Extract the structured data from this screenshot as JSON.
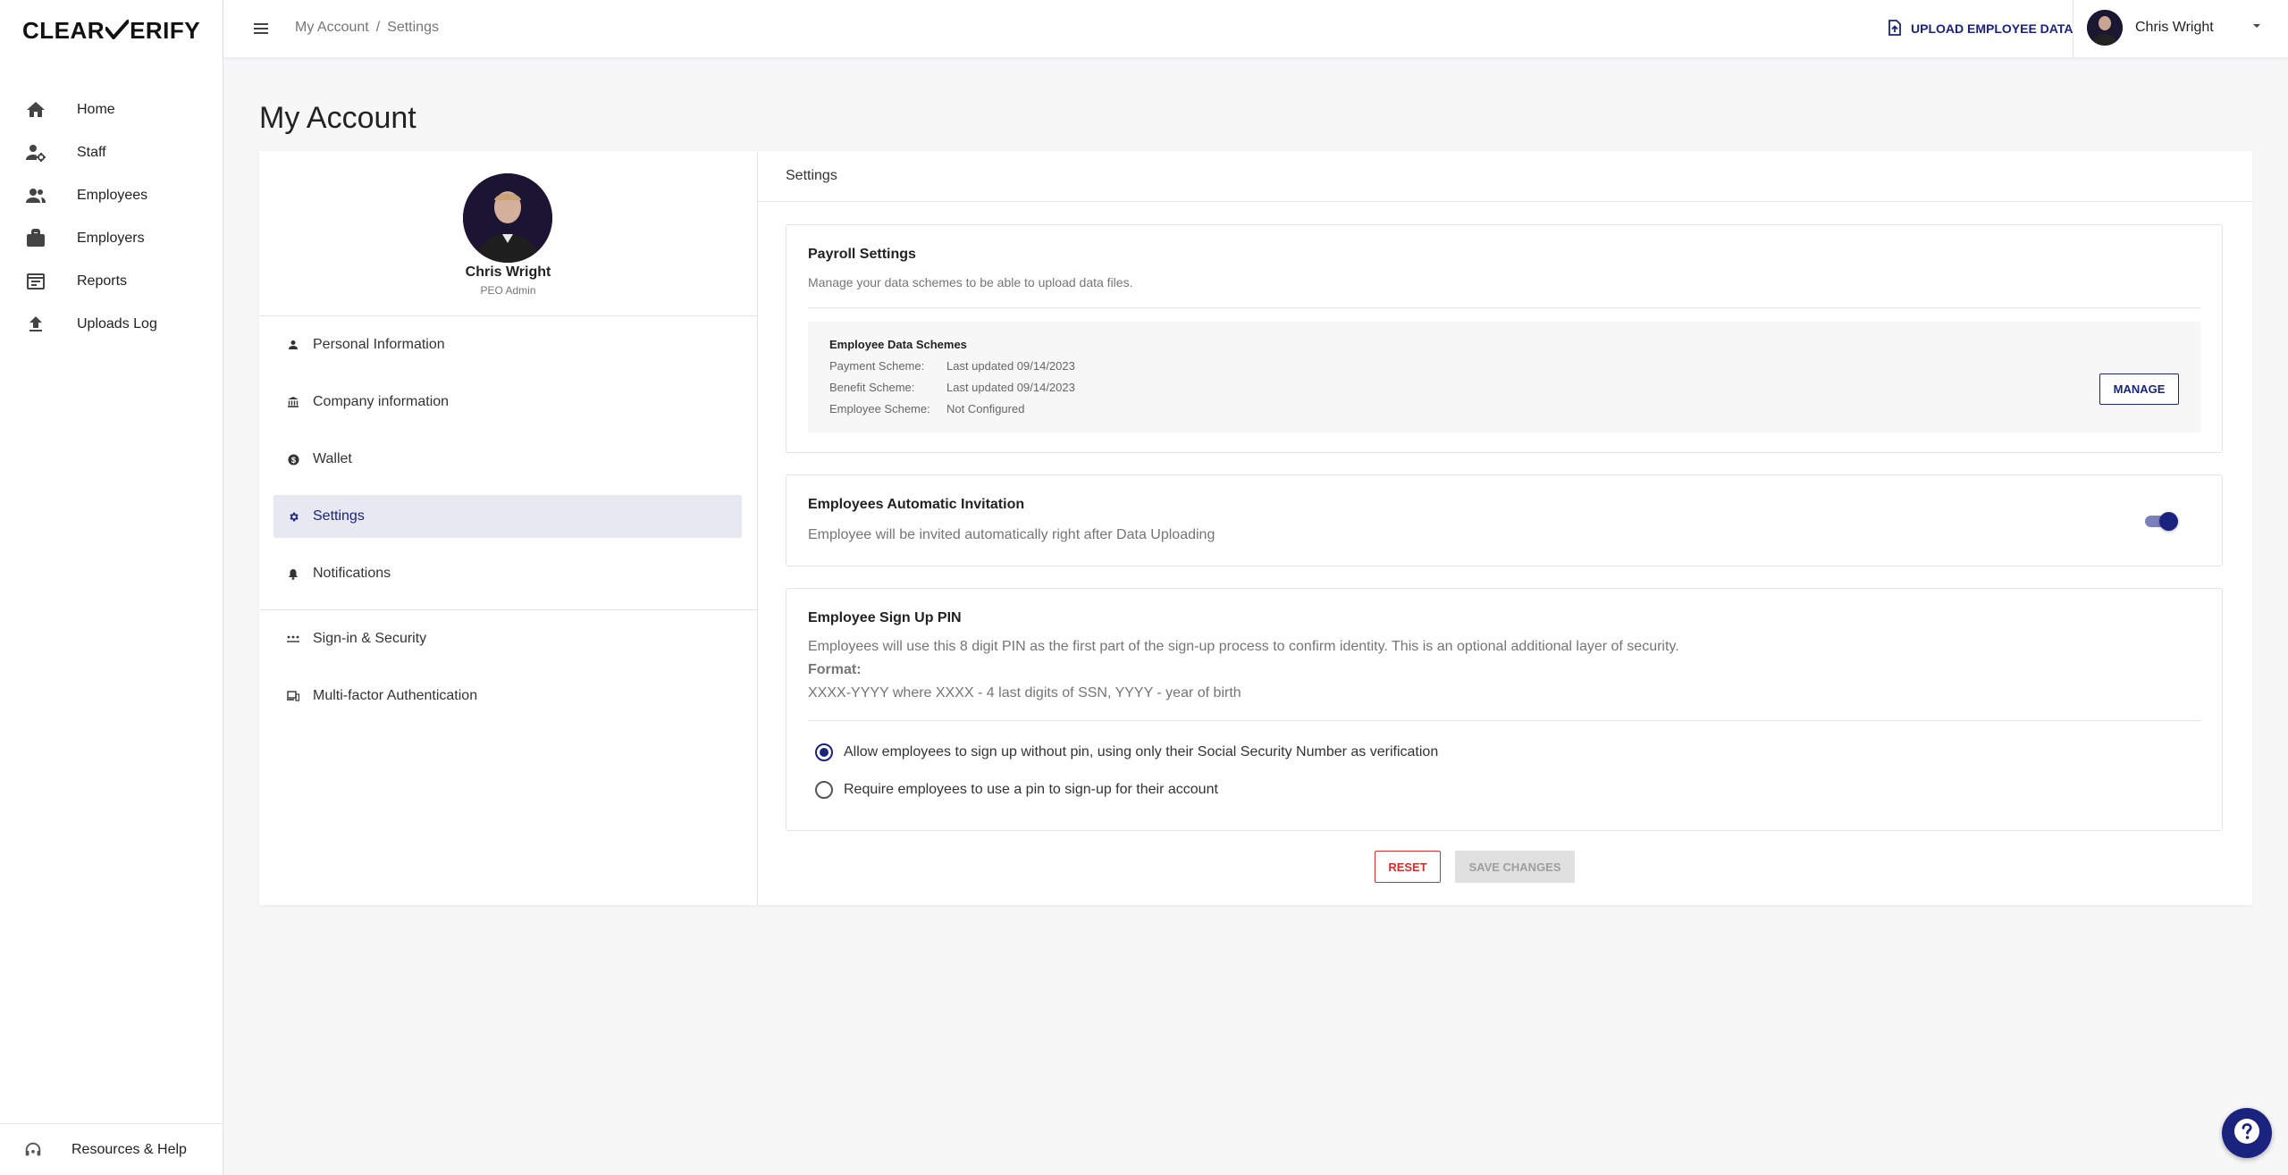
{
  "brand": {
    "name_left": "CLEAR",
    "name_right": "ERIFY",
    "accent": "#1a237e"
  },
  "sidebar": {
    "items": [
      {
        "label": "Home",
        "icon": "home-icon"
      },
      {
        "label": "Staff",
        "icon": "staff-icon"
      },
      {
        "label": "Employees",
        "icon": "employees-icon"
      },
      {
        "label": "Employers",
        "icon": "briefcase-icon"
      },
      {
        "label": "Reports",
        "icon": "reports-icon"
      },
      {
        "label": "Uploads Log",
        "icon": "upload-icon"
      }
    ],
    "footer": {
      "label": "Resources & Help",
      "icon": "headset-icon"
    }
  },
  "topbar": {
    "breadcrumb": [
      "My Account",
      "Settings"
    ],
    "breadcrumb_sep": "/",
    "upload_label": "UPLOAD EMPLOYEE DATA",
    "user_name": "Chris Wright"
  },
  "page": {
    "title": "My Account"
  },
  "profile": {
    "name": "Chris Wright",
    "role": "PEO Admin"
  },
  "account_menu": {
    "items": [
      {
        "label": "Personal Information",
        "icon": "person-icon"
      },
      {
        "label": "Company information",
        "icon": "bank-icon"
      },
      {
        "label": "Wallet",
        "icon": "dollar-icon"
      },
      {
        "label": "Settings",
        "icon": "gear-icon",
        "active": true
      },
      {
        "label": "Notifications",
        "icon": "bell-icon"
      }
    ],
    "security_items": [
      {
        "label": "Sign-in & Security",
        "icon": "password-icon"
      },
      {
        "label": "Multi-factor Authentication",
        "icon": "devices-icon"
      }
    ]
  },
  "settings": {
    "header": "Settings",
    "payroll": {
      "title": "Payroll Settings",
      "description": "Manage your data schemes to be able to upload data files.",
      "schemes_title": "Employee Data Schemes",
      "schemes": [
        {
          "label": "Payment Scheme:",
          "value": "Last updated 09/14/2023"
        },
        {
          "label": "Benefit Scheme:",
          "value": "Last updated 09/14/2023"
        },
        {
          "label": "Employee Scheme:",
          "value": "Not Configured"
        }
      ],
      "manage_label": "MANAGE"
    },
    "invitation": {
      "title": "Employees Automatic Invitation",
      "description": "Employee will be invited automatically right after Data Uploading",
      "enabled": true
    },
    "pin": {
      "title": "Employee Sign Up PIN",
      "description": "Employees will use this 8 digit PIN as the first part of the sign-up process to confirm identity. This is an optional additional layer of security.",
      "format_label": "Format:",
      "format_value": "XXXX-YYYY where XXXX - 4 last digits of SSN, YYYY - year of birth",
      "options": [
        {
          "label": "Allow employees to sign up without pin, using only their Social Security Number as verification",
          "selected": true
        },
        {
          "label": "Require employees to use a pin to sign-up for their account",
          "selected": false
        }
      ]
    },
    "reset_label": "RESET",
    "save_label": "SAVE CHANGES"
  }
}
